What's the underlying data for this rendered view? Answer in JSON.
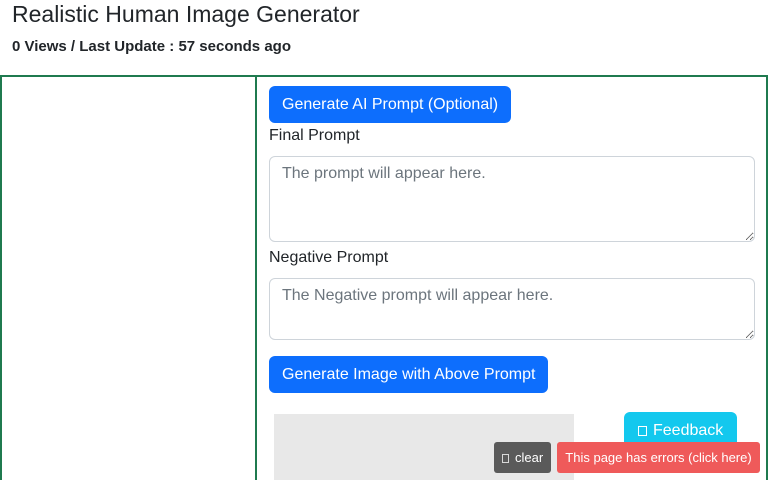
{
  "header": {
    "title": "Realistic Human Image Generator",
    "meta": "0 Views / Last Update : 57 seconds ago"
  },
  "form": {
    "ai_prompt_button": "Generate AI Prompt (Optional)",
    "final_prompt_label": "Final Prompt",
    "final_prompt_placeholder": "The prompt will appear here.",
    "final_prompt_value": "",
    "negative_prompt_label": "Negative Prompt",
    "negative_prompt_placeholder": "The Negative prompt will appear here.",
    "negative_prompt_value": "",
    "generate_button": "Generate Image with Above Prompt"
  },
  "feedback": {
    "label": "Feedback",
    "icon": "feedback-icon"
  },
  "debug": {
    "clear_label": "clear",
    "clear_icon": "trash-icon",
    "error_text": "This page has errors (click here)"
  },
  "colors": {
    "primary": "#0d6efd",
    "border_accent": "#1f7a4f",
    "feedback": "#13c8ee",
    "error": "#ef5a5a"
  }
}
